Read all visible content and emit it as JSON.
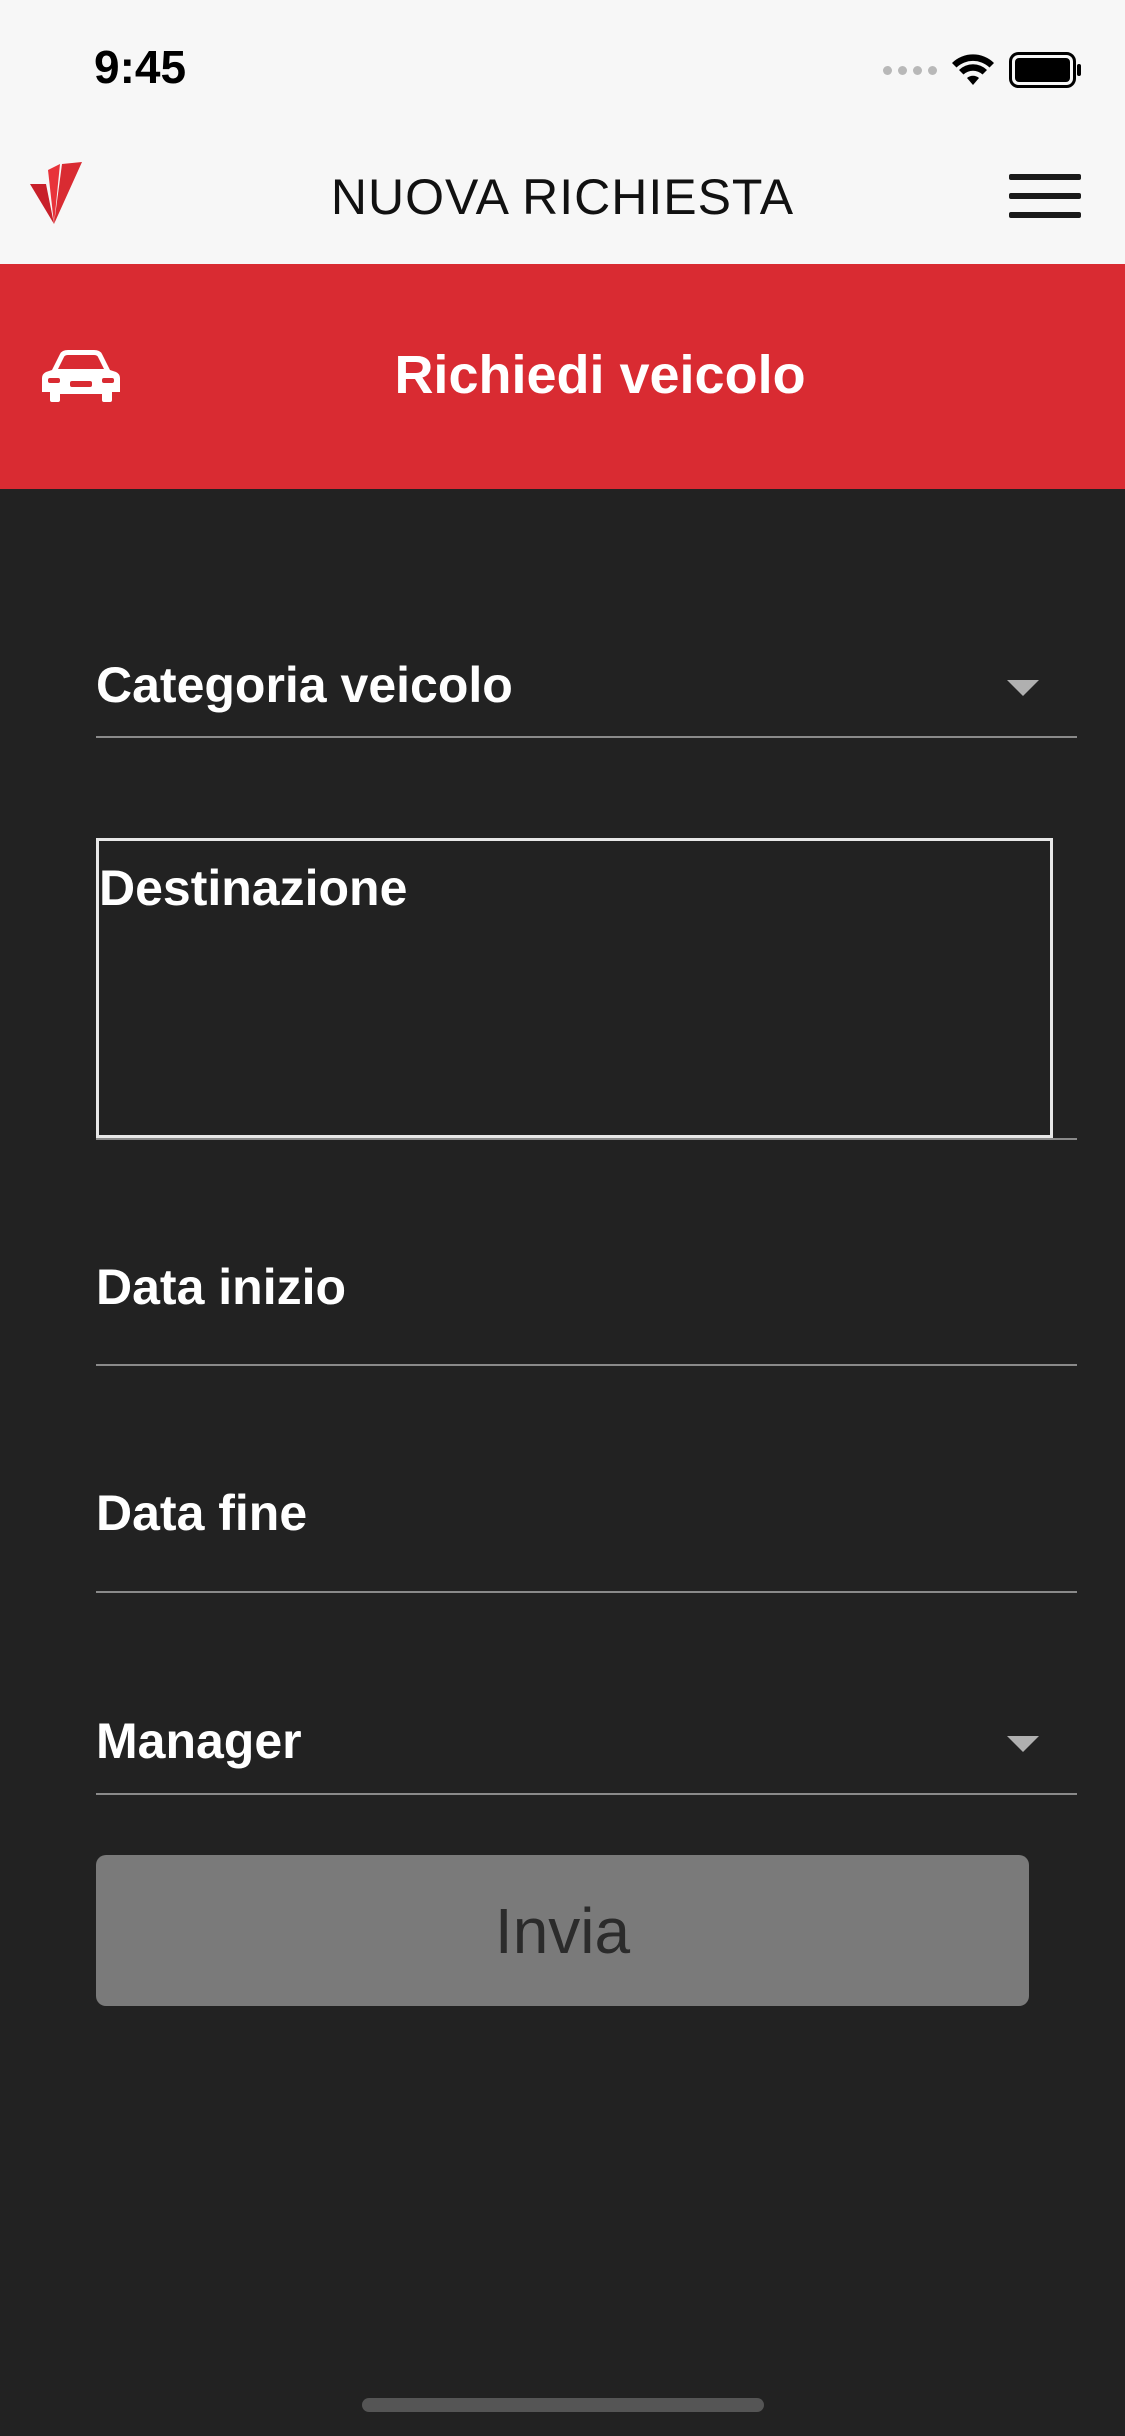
{
  "status_bar": {
    "time": "9:45",
    "signal_icon": "signal-dots-icon",
    "wifi_icon": "wifi-icon",
    "battery_icon": "battery-icon"
  },
  "nav_bar": {
    "logo_icon": "brand-logo",
    "title": "NUOVA RICHIESTA",
    "menu_icon": "hamburger-menu-icon"
  },
  "action_header": {
    "icon": "car-icon",
    "title": "Richiedi veicolo",
    "background_color": "#d92b32"
  },
  "form": {
    "vehicle_category": {
      "label": "Categoria veicolo",
      "icon": "chevron-down-icon"
    },
    "destination": {
      "label": "Destinazione"
    },
    "start_date": {
      "label": "Data inizio"
    },
    "end_date": {
      "label": "Data fine"
    },
    "manager": {
      "label": "Manager",
      "icon": "chevron-down-icon"
    },
    "submit_label": "Invia"
  },
  "colors": {
    "background": "#222222",
    "accent": "#d92b32",
    "button_disabled": "#7a7a7a"
  }
}
